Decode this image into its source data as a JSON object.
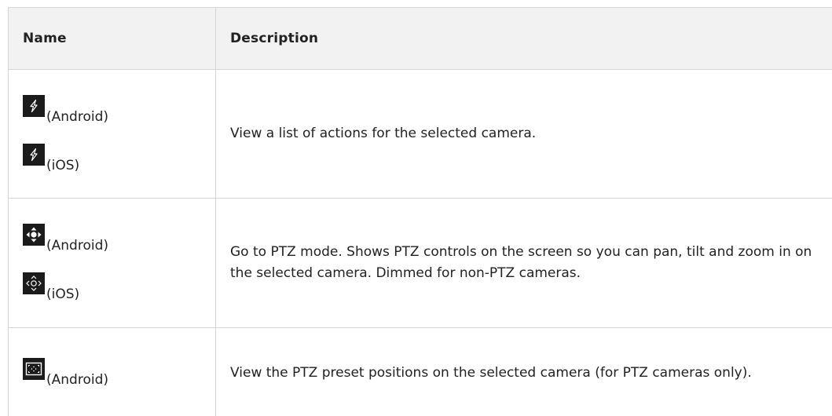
{
  "table": {
    "headers": {
      "name": "Name",
      "description": "Description"
    },
    "rows": [
      {
        "entries": [
          {
            "icon": "lightning-bolt-icon",
            "label": "(Android)"
          },
          {
            "icon": "lightning-bolt-icon",
            "label": "(iOS)"
          }
        ],
        "description": "View a list of actions for the selected camera."
      },
      {
        "entries": [
          {
            "icon": "ptz-arrows-filled-icon",
            "label": "(Android)"
          },
          {
            "icon": "ptz-arrows-outline-icon",
            "label": "(iOS)"
          }
        ],
        "description": "Go to PTZ mode. Shows PTZ controls on the screen so you can pan, tilt and zoom in on the selected camera. Dimmed for non-PTZ cameras."
      },
      {
        "entries": [
          {
            "icon": "ptz-preset-frame-icon",
            "label": "(Android)"
          }
        ],
        "description": "View the PTZ preset positions on the selected camera (for PTZ cameras only)."
      }
    ]
  },
  "colors": {
    "header_background": "#f2f2f2",
    "border": "#d6d6d6",
    "icon_background": "#1b1b1b",
    "text": "#222222"
  }
}
